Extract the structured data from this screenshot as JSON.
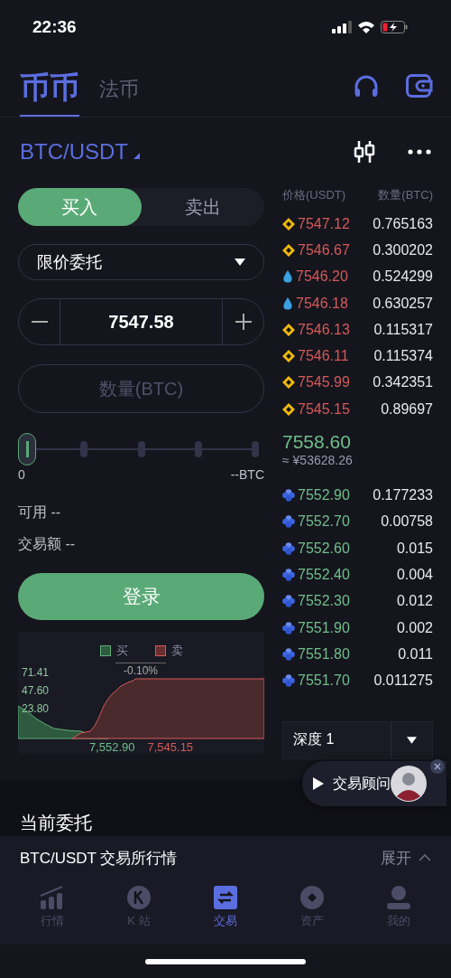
{
  "status_bar": {
    "time": "22:36"
  },
  "header_tabs": [
    {
      "label": "币币",
      "selected": true
    },
    {
      "label": "法币",
      "selected": false
    }
  ],
  "pair": {
    "label": "BTC/USDT"
  },
  "order_side": [
    {
      "label": "买入",
      "selected": true
    },
    {
      "label": "卖出",
      "selected": false
    }
  ],
  "order_type": {
    "value": "限价委托"
  },
  "price": {
    "value": "7547.58"
  },
  "amount": {
    "placeholder": "数量(BTC)"
  },
  "slider": {
    "level": 0,
    "min_label": "0",
    "max_label": "--BTC"
  },
  "available": {
    "label": "可用 --"
  },
  "turnover": {
    "label": "交易额 --"
  },
  "login_button": "登录",
  "depth_chart": {
    "legend": [
      {
        "label": "买",
        "color": "#2e5a3f"
      },
      {
        "label": "卖",
        "color": "#6a2e2e"
      }
    ],
    "change": "-0.10%",
    "y_labels": [
      "71.41",
      "47.60",
      "23.80"
    ],
    "bid_label": "7,552.90",
    "ask_label": "7,545.15"
  },
  "order_book": {
    "columns": [
      "价格(USDT)",
      "数量(BTC)"
    ],
    "asks": [
      {
        "kind": "diamond",
        "price": "7547.12",
        "amount": "0.765163"
      },
      {
        "kind": "diamond",
        "price": "7546.67",
        "amount": "0.300202"
      },
      {
        "kind": "drop",
        "price": "7546.20",
        "amount": "0.524299"
      },
      {
        "kind": "drop",
        "price": "7546.18",
        "amount": "0.630257"
      },
      {
        "kind": "diamond",
        "price": "7546.13",
        "amount": "0.115317"
      },
      {
        "kind": "diamond",
        "price": "7546.11",
        "amount": "0.115374"
      },
      {
        "kind": "diamond",
        "price": "7545.99",
        "amount": "0.342351"
      },
      {
        "kind": "diamond",
        "price": "7545.15",
        "amount": "0.89697"
      }
    ],
    "last_price": "7558.60",
    "last_price_cny": "≈ ¥53628.26",
    "bids": [
      {
        "kind": "cluster",
        "price": "7552.90",
        "amount": "0.177233"
      },
      {
        "kind": "cluster",
        "price": "7552.70",
        "amount": "0.00758"
      },
      {
        "kind": "cluster",
        "price": "7552.60",
        "amount": "0.015"
      },
      {
        "kind": "cluster",
        "price": "7552.40",
        "amount": "0.004"
      },
      {
        "kind": "cluster",
        "price": "7552.30",
        "amount": "0.012"
      },
      {
        "kind": "cluster",
        "price": "7551.90",
        "amount": "0.002"
      },
      {
        "kind": "cluster",
        "price": "7551.80",
        "amount": "0.011"
      },
      {
        "kind": "cluster",
        "price": "7551.70",
        "amount": "0.011275"
      }
    ],
    "depth": "深度 1"
  },
  "advisor": {
    "label": "交易顾问"
  },
  "open_orders": {
    "title": "当前委托"
  },
  "market_bar": {
    "title": "BTC/USDT 交易所行情",
    "action": "展开"
  },
  "bottom_tabs": [
    {
      "kind": "chart",
      "label": "行情",
      "selected": false
    },
    {
      "kind": "k",
      "label": "K 站",
      "selected": false
    },
    {
      "kind": "trade",
      "label": "交易",
      "selected": true
    },
    {
      "kind": "assets",
      "label": "资产",
      "selected": false
    },
    {
      "kind": "user",
      "label": "我的",
      "selected": false
    }
  ]
}
